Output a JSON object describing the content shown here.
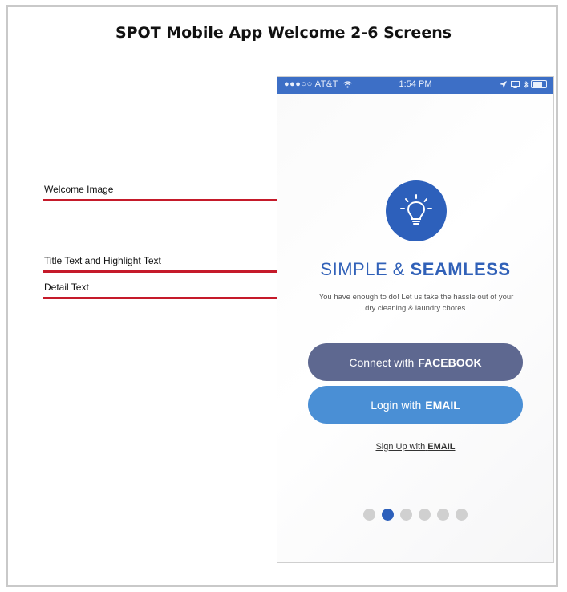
{
  "page_title": "SPOT Mobile App Welcome 2-6 Screens",
  "annotations": {
    "welcome_image": "Welcome Image",
    "title_text": "Title Text and Highlight Text",
    "detail_text": "Detail Text"
  },
  "status_bar": {
    "carrier": "●●●○○ AT&T",
    "time": "1:54 PM"
  },
  "welcome": {
    "icon": "lightbulb-icon",
    "title": "SIMPLE &",
    "highlight": "SEAMLESS",
    "detail_line1": "You have enough to do! Let us take the hassle out of your",
    "detail_line2": "dry cleaning & laundry chores."
  },
  "buttons": {
    "facebook_prefix": "Connect with",
    "facebook_bold": "FACEBOOK",
    "email_prefix": "Login with",
    "email_bold": "EMAIL",
    "signup_prefix": "Sign Up with",
    "signup_bold": "EMAIL"
  },
  "pagination": {
    "total": 6,
    "active_index": 1
  },
  "colors": {
    "brand_blue": "#2d60bb",
    "status_bar": "#3d6fc6",
    "facebook_button": "#5e6890",
    "email_button": "#4a8fd5",
    "annotation_line": "#c51a2a"
  }
}
